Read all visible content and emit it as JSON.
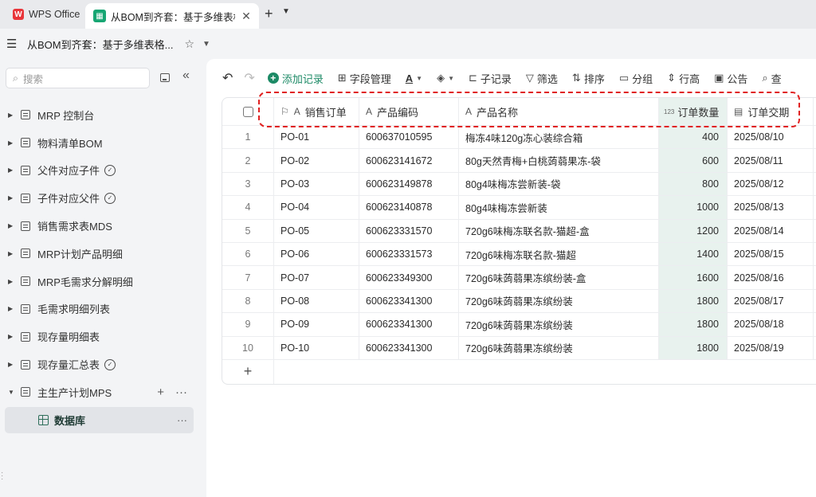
{
  "titlebar": {
    "app_tab": "WPS Office",
    "doc_tab": "从BOM到齐套：基于多维表格构建",
    "close": "✕",
    "add": "+",
    "more": "⌄"
  },
  "docbar": {
    "menu": "☰",
    "title": "从BOM到齐套：基于多维表格...",
    "star": "☆",
    "caret": "⌄"
  },
  "sidebar": {
    "search_placeholder": "搜索",
    "collapse": "«",
    "items": [
      {
        "label": "MRP 控制台",
        "badge": false
      },
      {
        "label": "物料清单BOM",
        "badge": false
      },
      {
        "label": "父件对应子件",
        "badge": true
      },
      {
        "label": "子件对应父件",
        "badge": true
      },
      {
        "label": "销售需求表MDS",
        "badge": false
      },
      {
        "label": "MRP计划产品明细",
        "badge": false
      },
      {
        "label": "MRP毛需求分解明细",
        "badge": false
      },
      {
        "label": "毛需求明细列表",
        "badge": false
      },
      {
        "label": "现存量明细表",
        "badge": false
      },
      {
        "label": "现存量汇总表",
        "badge": true
      },
      {
        "label": "主生产计划MPS",
        "badge": false
      }
    ],
    "sub_item": "数据库"
  },
  "toolbar": {
    "add_record": "添加记录",
    "field_manage": "字段管理",
    "font_color": "A",
    "sub_record": "子记录",
    "filter": "筛选",
    "sort": "排序",
    "group": "分组",
    "row_height": "行高",
    "notice": "公告",
    "search": "查"
  },
  "table": {
    "columns": [
      "销售订单",
      "产品编码",
      "产品名称",
      "订单数量",
      "订单交期"
    ],
    "rows": [
      {
        "idx": "1",
        "po": "PO-01",
        "code": "600637010595",
        "name": "梅冻4味120g冻心装综合箱",
        "qty": "400",
        "date": "2025/08/10"
      },
      {
        "idx": "2",
        "po": "PO-02",
        "code": "600623141672",
        "name": "80g天然青梅+白桃蒟蒻果冻-袋",
        "qty": "600",
        "date": "2025/08/11"
      },
      {
        "idx": "3",
        "po": "PO-03",
        "code": "600623149878",
        "name": "80g4味梅冻尝新装-袋",
        "qty": "800",
        "date": "2025/08/12"
      },
      {
        "idx": "4",
        "po": "PO-04",
        "code": "600623140878",
        "name": "80g4味梅冻尝新装",
        "qty": "1000",
        "date": "2025/08/13"
      },
      {
        "idx": "5",
        "po": "PO-05",
        "code": "600623331570",
        "name": "720g6味梅冻联名款-猫超-盒",
        "qty": "1200",
        "date": "2025/08/14"
      },
      {
        "idx": "6",
        "po": "PO-06",
        "code": "600623331573",
        "name": "720g6味梅冻联名款-猫超",
        "qty": "1400",
        "date": "2025/08/15"
      },
      {
        "idx": "7",
        "po": "PO-07",
        "code": "600623349300",
        "name": "720g6味蒟蒻果冻缤纷装-盒",
        "qty": "1600",
        "date": "2025/08/16"
      },
      {
        "idx": "8",
        "po": "PO-08",
        "code": "600623341300",
        "name": "720g6味蒟蒻果冻缤纷装",
        "qty": "1800",
        "date": "2025/08/17"
      },
      {
        "idx": "9",
        "po": "PO-09",
        "code": "600623341300",
        "name": "720g6味蒟蒻果冻缤纷装",
        "qty": "1800",
        "date": "2025/08/18"
      },
      {
        "idx": "10",
        "po": "PO-10",
        "code": "600623341300",
        "name": "720g6味蒟蒻果冻缤纷装",
        "qty": "1800",
        "date": "2025/08/19"
      }
    ]
  },
  "colors": {
    "accent": "#1d8a66",
    "highlight": "#e02020",
    "qty_column_bg": "#e8f2ee"
  }
}
